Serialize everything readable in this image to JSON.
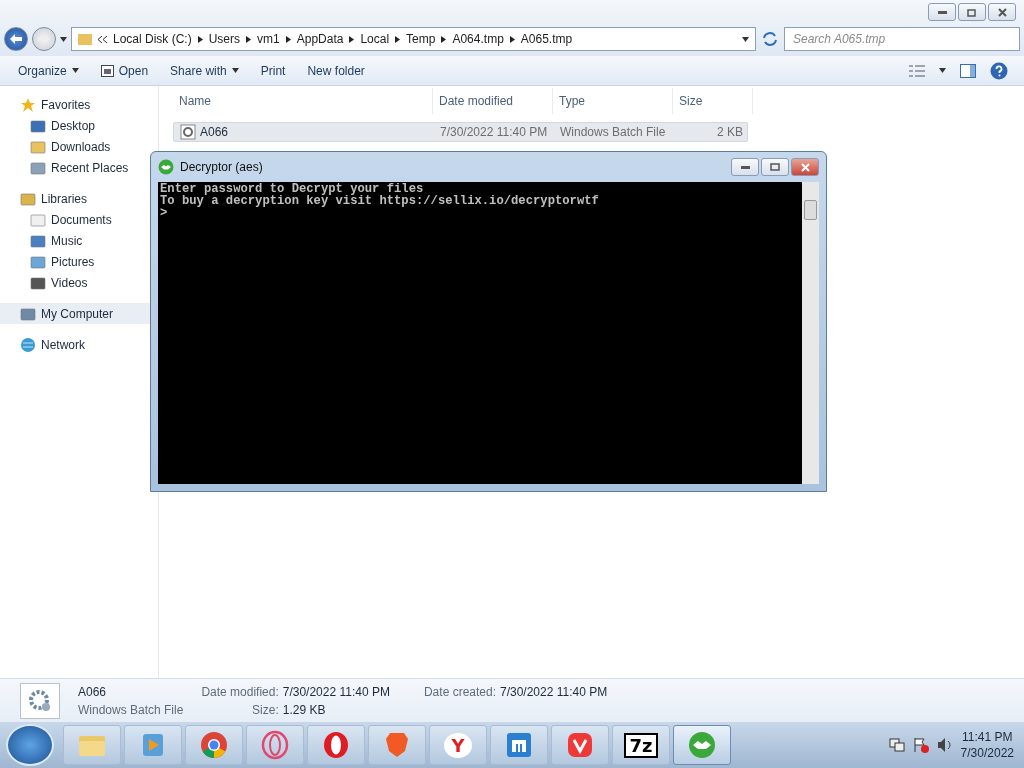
{
  "address": {
    "crumbs": [
      "Local Disk (C:)",
      "Users",
      "vm1",
      "AppData",
      "Local",
      "Temp",
      "A064.tmp",
      "A065.tmp"
    ]
  },
  "search": {
    "placeholder": "Search A065.tmp"
  },
  "toolbar": [
    {
      "label": "Organize",
      "kind": "menu"
    },
    {
      "label": "Open",
      "kind": "open"
    },
    {
      "label": "Share with",
      "kind": "menu"
    },
    {
      "label": "Print",
      "kind": "plain"
    },
    {
      "label": "New folder",
      "kind": "plain"
    }
  ],
  "sidebar": [
    {
      "label": "Favorites",
      "kind": "star",
      "children": [
        {
          "label": "Desktop",
          "kind": "desktop",
          "selected": false
        },
        {
          "label": "Downloads",
          "kind": "folder",
          "selected": false
        },
        {
          "label": "Recent Places",
          "kind": "recent",
          "selected": false
        }
      ]
    },
    {
      "label": "Libraries",
      "kind": "library",
      "children": [
        {
          "label": "Documents",
          "kind": "doc",
          "selected": false
        },
        {
          "label": "Music",
          "kind": "music",
          "selected": false
        },
        {
          "label": "Pictures",
          "kind": "pic",
          "selected": false
        },
        {
          "label": "Videos",
          "kind": "video",
          "selected": false
        }
      ]
    },
    {
      "label": "My Computer",
      "kind": "computer",
      "selected": true
    },
    {
      "label": "Network",
      "kind": "network"
    }
  ],
  "table": {
    "columns": [
      "Name",
      "Date modified",
      "Type",
      "Size"
    ],
    "rows": [
      {
        "name": "A066",
        "date": "7/30/2022 11:40 PM",
        "type": "Windows Batch File",
        "size": "2 KB",
        "selected": true
      }
    ]
  },
  "console": {
    "title": "Decryptor (aes)",
    "lines": [
      "Enter password to Decrypt your files",
      "To buy a decryption key visit https://sellix.io/decryptorwtf",
      ">"
    ]
  },
  "details": {
    "name": "A066",
    "type": "Windows Batch File",
    "fields": [
      {
        "label": "Date modified:",
        "value": "7/30/2022 11:40 PM"
      },
      {
        "label": "Size:",
        "value": "1.29 KB"
      },
      {
        "label": "Date created:",
        "value": "7/30/2022 11:40 PM"
      }
    ]
  },
  "taskbar": {
    "apps": [
      {
        "kind": "folder",
        "active": false
      },
      {
        "kind": "media",
        "active": false
      },
      {
        "kind": "chrome",
        "active": false
      },
      {
        "kind": "operagx",
        "active": false
      },
      {
        "kind": "opera",
        "active": false
      },
      {
        "kind": "brave",
        "active": false
      },
      {
        "kind": "yandex",
        "glyph": "Y",
        "active": false
      },
      {
        "kind": "maxthon",
        "active": false
      },
      {
        "kind": "vivaldi",
        "active": false
      },
      {
        "kind": "sevenzip",
        "glyph": "7z",
        "active": false
      },
      {
        "kind": "decryptor",
        "active": true
      }
    ],
    "time": "11:41 PM",
    "date": "7/30/2022"
  }
}
